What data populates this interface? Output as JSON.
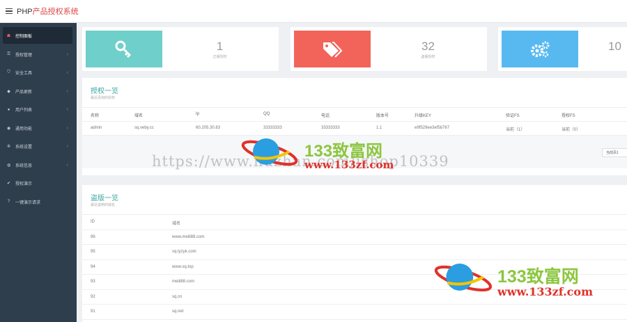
{
  "header": {
    "title_prefix": "PHP",
    "title_suffix": "产品授权系统"
  },
  "sidebar": {
    "items": [
      {
        "label": "控制面板",
        "icon": "dashboard-icon",
        "glyph": "☗",
        "arrow": ""
      },
      {
        "label": "授权管理",
        "icon": "key-icon",
        "glyph": "⚿",
        "arrow": "‹"
      },
      {
        "label": "安全工具",
        "icon": "shield-icon",
        "glyph": "⛉",
        "arrow": "‹"
      },
      {
        "label": "产品更新",
        "icon": "tag-icon",
        "glyph": "◆",
        "arrow": "‹"
      },
      {
        "label": "用户列表",
        "icon": "user-icon",
        "glyph": "●",
        "arrow": "‹"
      },
      {
        "label": "通用功能",
        "icon": "bell-icon",
        "glyph": "◉",
        "arrow": "‹"
      },
      {
        "label": "系统设置",
        "icon": "gears-icon",
        "glyph": "✲",
        "arrow": "‹"
      },
      {
        "label": "系统信息",
        "icon": "info-icon",
        "glyph": "◍",
        "arrow": "‹"
      },
      {
        "label": "授权演示",
        "icon": "check-icon",
        "glyph": "✔",
        "arrow": ""
      },
      {
        "label": "一键演示请求",
        "icon": "question-icon",
        "glyph": "?",
        "arrow": ""
      }
    ]
  },
  "stats": [
    {
      "value": "1",
      "label": "正版授权",
      "color": "#6fcfcb",
      "icon": "key-icon"
    },
    {
      "value": "32",
      "label": "盗版授权",
      "color": "#f2645a",
      "icon": "tags-icon"
    },
    {
      "value": "10",
      "label": "",
      "color": "#58b9f0",
      "icon": "gears-icon"
    }
  ],
  "licenses": {
    "title": "授权一览",
    "subtitle": "最近添加的授权",
    "headers": [
      "名称",
      "域名",
      "Ip",
      "QQ",
      "电话",
      "版本号",
      "升级KEY",
      "验证FS",
      "授权FS"
    ],
    "rows": [
      [
        "admin",
        "sq.veby.cc",
        "60.205.30.83",
        "33333333",
        "33333333",
        "1.1",
        "e9f529ee3ef5b767",
        "当前（1）",
        "当前（0）"
      ]
    ],
    "pager_label": "当前页1"
  },
  "piracy": {
    "title": "盗版一览",
    "subtitle": "最近盗用的域名",
    "headers": [
      "ID",
      "域名"
    ],
    "rows": [
      [
        "96",
        "www.meili88.com"
      ],
      [
        "95",
        "sq.tyzyk.com"
      ],
      [
        "94",
        "www.sq.top"
      ],
      [
        "93",
        "meili88.com"
      ],
      [
        "92",
        "sq.cn"
      ],
      [
        "91",
        "sq.net"
      ]
    ]
  },
  "watermark": {
    "url": "https://www.huzhan.com/ishop10339",
    "brand": "133致富网",
    "domain": "www.133zf.com"
  }
}
